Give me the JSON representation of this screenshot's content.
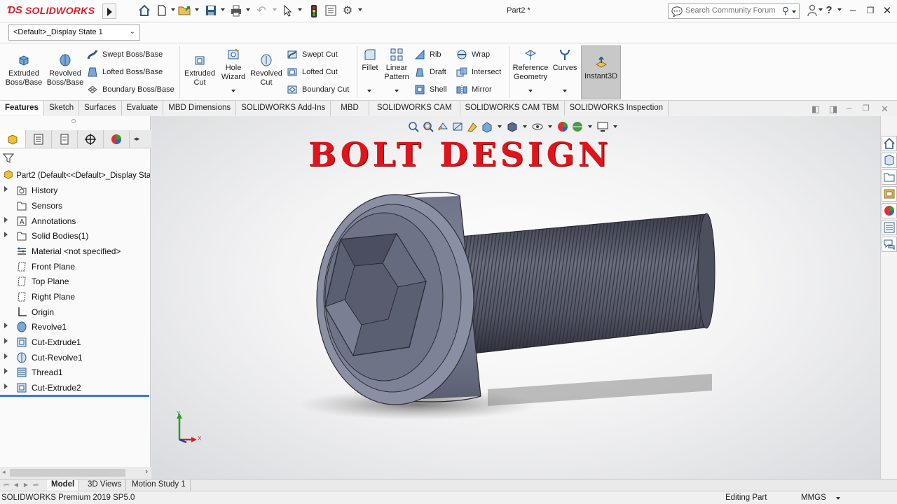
{
  "app": {
    "brand": "SOLIDWORKS",
    "doc_title": "Part2 *"
  },
  "search": {
    "placeholder": "Search Community Forum"
  },
  "config": {
    "display_state": "<Default>_Display State 1"
  },
  "ribbon": {
    "extruded_boss": "Extruded Boss/Base",
    "revolved_boss": "Revolved Boss/Base",
    "swept_boss": "Swept Boss/Base",
    "lofted_boss": "Lofted Boss/Base",
    "boundary_boss": "Boundary Boss/Base",
    "extruded_cut": "Extruded Cut",
    "hole_wizard": "Hole Wizard",
    "revolved_cut": "Revolved Cut",
    "swept_cut": "Swept Cut",
    "lofted_cut": "Lofted Cut",
    "boundary_cut": "Boundary Cut",
    "fillet": "Fillet",
    "linear_pattern": "Linear Pattern",
    "rib": "Rib",
    "draft": "Draft",
    "shell": "Shell",
    "wrap": "Wrap",
    "intersect": "Intersect",
    "mirror": "Mirror",
    "reference_geometry": "Reference Geometry",
    "curves": "Curves",
    "instant3d": "Instant3D"
  },
  "tabs": [
    "Features",
    "Sketch",
    "Surfaces",
    "Evaluate",
    "MBD Dimensions",
    "SOLIDWORKS Add-Ins",
    "MBD",
    "SOLIDWORKS CAM",
    "SOLIDWORKS CAM TBM",
    "SOLIDWORKS Inspection"
  ],
  "tree": {
    "root": "Part2  (Default<<Default>_Display Stat",
    "items": [
      {
        "label": "History"
      },
      {
        "label": "Sensors"
      },
      {
        "label": "Annotations"
      },
      {
        "label": "Solid Bodies(1)"
      },
      {
        "label": "Material <not specified>"
      },
      {
        "label": "Front Plane"
      },
      {
        "label": "Top Plane"
      },
      {
        "label": "Right Plane"
      },
      {
        "label": "Origin"
      },
      {
        "label": "Revolve1"
      },
      {
        "label": "Cut-Extrude1"
      },
      {
        "label": "Cut-Revolve1"
      },
      {
        "label": "Thread1"
      },
      {
        "label": "Cut-Extrude2"
      }
    ]
  },
  "viewport": {
    "overlay_title": "BOLT DESIGN",
    "axis_y": "Y",
    "axis_x": "X"
  },
  "bottom_tabs": [
    "Model",
    "3D Views",
    "Motion Study 1"
  ],
  "status": {
    "version": "SOLIDWORKS Premium 2019 SP5.0",
    "mode": "Editing Part",
    "units": "MMGS"
  },
  "colors": {
    "brand_red": "#d4202b",
    "title_red": "#e0141c",
    "rollback_blue": "#3a7fc9"
  }
}
